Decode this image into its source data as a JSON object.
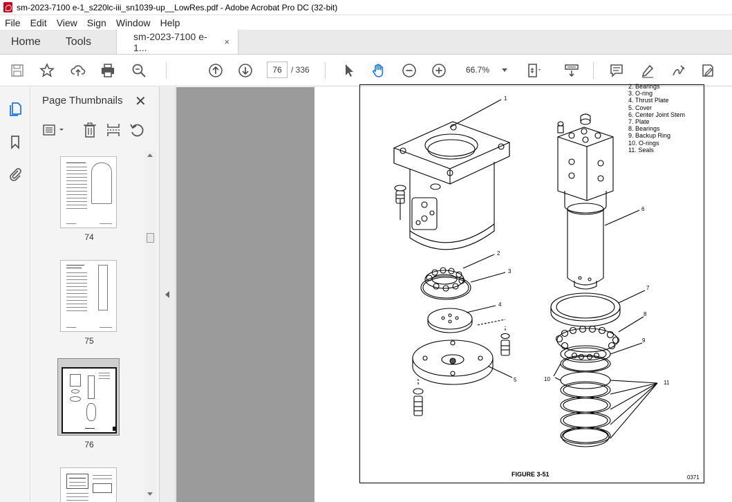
{
  "window": {
    "title": "sm-2023-7100 e-1_s220lc-iii_sn1039-up__LowRes.pdf - Adobe Acrobat Pro DC (32-bit)"
  },
  "menu": [
    "File",
    "Edit",
    "View",
    "Sign",
    "Window",
    "Help"
  ],
  "tabs": {
    "home": "Home",
    "tools": "Tools",
    "document": "sm-2023-7100 e-1...",
    "close": "×"
  },
  "toolbar": {
    "page_current": "76",
    "page_total": "/ 336",
    "zoom": "66.7%"
  },
  "panel": {
    "title": "Page Thumbnails",
    "close": "✕",
    "thumbnails": [
      {
        "label": "74"
      },
      {
        "label": "75"
      },
      {
        "label": "76"
      }
    ]
  },
  "document": {
    "legend": [
      "2.  Bearings",
      "3.  O-ring",
      "4.  Thrust Plate",
      "5.  Cover",
      "6.  Center Joint Stem",
      "7.  Plate",
      "8.  Bearings",
      "9.  Backup Ring",
      "10.  O-rings",
      "11.  Seals"
    ],
    "callouts": [
      "1",
      "2",
      "3",
      "4",
      "5",
      "6",
      "7",
      "8",
      "9",
      "10",
      "11"
    ],
    "caption": "FIGURE 3-51",
    "code": "0371"
  }
}
